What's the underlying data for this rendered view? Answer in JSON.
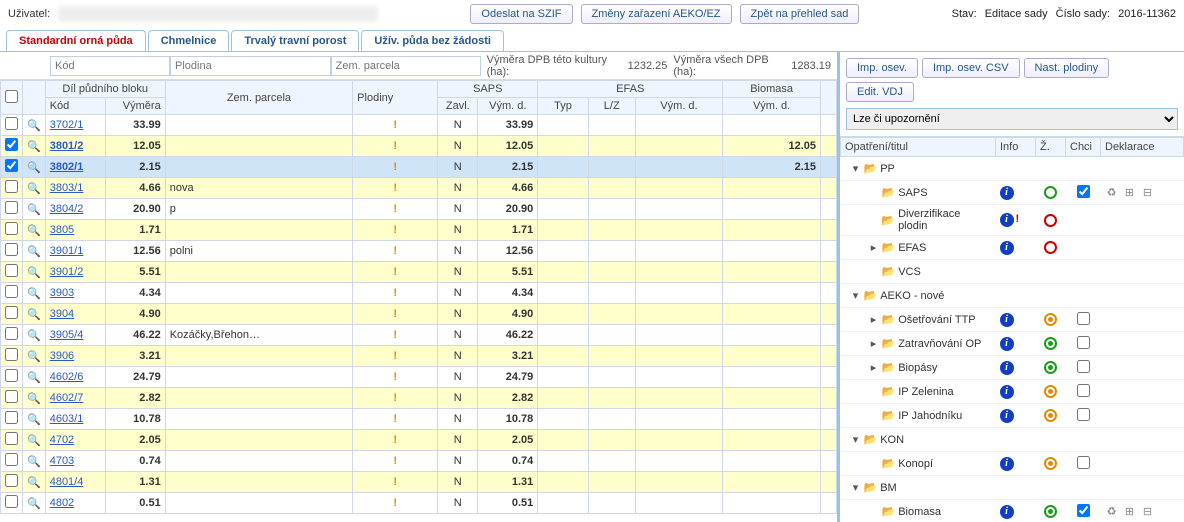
{
  "topbar": {
    "user_label": "Uživatel:",
    "btn_odeslat": "Odeslat na SZIF",
    "btn_zmeny": "Změny zařazení AEKO/EZ",
    "btn_zpet": "Zpět na přehled sad",
    "stav_label": "Stav:",
    "stav_value": "Editace sady",
    "cislo_label": "Číslo sady:",
    "cislo_value": "2016-11362"
  },
  "tabs": [
    "Standardní orná půda",
    "Chmelnice",
    "Trvalý travní porost",
    "Užív. půda bez žádosti"
  ],
  "filters": {
    "kod": "Kód",
    "plodina": "Plodina",
    "zem": "Zem. parcela",
    "metric1_label": "Výměra DPB této kultury (ha):",
    "metric1_value": "1232.25",
    "metric2_label": "Výměra všech DPB (ha):",
    "metric2_value": "1283.19"
  },
  "grid_headers": {
    "dpb": "Díl půdního bloku",
    "kod": "Kód",
    "vymera": "Výměra",
    "zem": "Zem. parcela",
    "plodiny": "Plodiny",
    "saps": "SAPS",
    "zavl": "Zavl.",
    "vymd": "Vým. d.",
    "efas": "EFAS",
    "typ": "Typ",
    "lz": "L/Z",
    "biomasa": "Biomasa"
  },
  "rows": [
    {
      "chk": false,
      "kod": "3702/1",
      "vym": "33.99",
      "zem": "",
      "excl": true,
      "zavl": "N",
      "sapsvym": "33.99",
      "biovym": "",
      "yellow": false
    },
    {
      "chk": true,
      "kod": "3801/2",
      "vym": "12.05",
      "zem": "",
      "excl": true,
      "zavl": "N",
      "sapsvym": "12.05",
      "biovym": "12.05",
      "yellow": true,
      "bold": true
    },
    {
      "chk": true,
      "kod": "3802/1",
      "vym": "2.15",
      "zem": "",
      "excl": true,
      "zavl": "N",
      "sapsvym": "2.15",
      "biovym": "2.15",
      "selblue": true,
      "bold": true
    },
    {
      "chk": false,
      "kod": "3803/1",
      "vym": "4.66",
      "zem": "nova",
      "excl": true,
      "zavl": "N",
      "sapsvym": "4.66",
      "biovym": "",
      "yellow": true
    },
    {
      "chk": false,
      "kod": "3804/2",
      "vym": "20.90",
      "zem": "p",
      "excl": true,
      "zavl": "N",
      "sapsvym": "20.90",
      "biovym": "",
      "yellow": false
    },
    {
      "chk": false,
      "kod": "3805",
      "vym": "1.71",
      "zem": "",
      "excl": true,
      "zavl": "N",
      "sapsvym": "1.71",
      "biovym": "",
      "yellow": true
    },
    {
      "chk": false,
      "kod": "3901/1",
      "vym": "12.56",
      "zem": "polni",
      "excl": true,
      "zavl": "N",
      "sapsvym": "12.56",
      "biovym": "",
      "yellow": false
    },
    {
      "chk": false,
      "kod": "3901/2",
      "vym": "5.51",
      "zem": "",
      "excl": true,
      "zavl": "N",
      "sapsvym": "5.51",
      "biovym": "",
      "yellow": true
    },
    {
      "chk": false,
      "kod": "3903",
      "vym": "4.34",
      "zem": "",
      "excl": true,
      "zavl": "N",
      "sapsvym": "4.34",
      "biovym": "",
      "yellow": false
    },
    {
      "chk": false,
      "kod": "3904",
      "vym": "4.90",
      "zem": "",
      "excl": true,
      "zavl": "N",
      "sapsvym": "4.90",
      "biovym": "",
      "yellow": true
    },
    {
      "chk": false,
      "kod": "3905/4",
      "vym": "46.22",
      "zem": "Kozáčky,Břehon…",
      "excl": true,
      "zavl": "N",
      "sapsvym": "46.22",
      "biovym": "",
      "yellow": false
    },
    {
      "chk": false,
      "kod": "3906",
      "vym": "3.21",
      "zem": "",
      "excl": true,
      "zavl": "N",
      "sapsvym": "3.21",
      "biovym": "",
      "yellow": true
    },
    {
      "chk": false,
      "kod": "4602/6",
      "vym": "24.79",
      "zem": "",
      "excl": true,
      "zavl": "N",
      "sapsvym": "24.79",
      "biovym": "",
      "yellow": false
    },
    {
      "chk": false,
      "kod": "4602/7",
      "vym": "2.82",
      "zem": "",
      "excl": true,
      "zavl": "N",
      "sapsvym": "2.82",
      "biovym": "",
      "yellow": true
    },
    {
      "chk": false,
      "kod": "4603/1",
      "vym": "10.78",
      "zem": "",
      "excl": true,
      "zavl": "N",
      "sapsvym": "10.78",
      "biovym": "",
      "yellow": false
    },
    {
      "chk": false,
      "kod": "4702",
      "vym": "2.05",
      "zem": "",
      "excl": true,
      "zavl": "N",
      "sapsvym": "2.05",
      "biovym": "",
      "yellow": true
    },
    {
      "chk": false,
      "kod": "4703",
      "vym": "0.74",
      "zem": "",
      "excl": true,
      "zavl": "N",
      "sapsvym": "0.74",
      "biovym": "",
      "yellow": false
    },
    {
      "chk": false,
      "kod": "4801/4",
      "vym": "1.31",
      "zem": "",
      "excl": true,
      "zavl": "N",
      "sapsvym": "1.31",
      "biovym": "",
      "yellow": true
    },
    {
      "chk": false,
      "kod": "4802",
      "vym": "0.51",
      "zem": "",
      "excl": true,
      "zavl": "N",
      "sapsvym": "0.51",
      "biovym": "",
      "yellow": false
    }
  ],
  "right": {
    "btn_imp_osev": "Imp. osev.",
    "btn_imp_csv": "Imp. osev. CSV",
    "btn_nast": "Nast. plodiny",
    "btn_edit_vdj": "Edit. VDJ",
    "select_value": "Lze či upozornění",
    "headers": {
      "op": "Opatření/titul",
      "info": "Info",
      "z": "Ž.",
      "chci": "Chci",
      "dekl": "Deklarace"
    },
    "tree": [
      {
        "level": 0,
        "arrow": "▾",
        "label": "PP"
      },
      {
        "level": 1,
        "arrow": "",
        "label": "SAPS",
        "info": true,
        "z": "ring-green",
        "chci": "chk-on",
        "dekl": true
      },
      {
        "level": 1,
        "arrow": "",
        "label": "Diverzifikace plodin",
        "info": true,
        "warn": true,
        "z": "ring-red"
      },
      {
        "level": 1,
        "arrow": "▸",
        "label": "EFAS",
        "info": true,
        "z": "ring-red"
      },
      {
        "level": 1,
        "arrow": "",
        "label": "VCS"
      },
      {
        "level": 0,
        "arrow": "▾",
        "label": "AEKO - nové"
      },
      {
        "level": 1,
        "arrow": "▸",
        "label": "Ošetřování TTP",
        "info": true,
        "z": "dot-orange",
        "chci": "chk-off"
      },
      {
        "level": 1,
        "arrow": "▸",
        "label": "Zatravňování OP",
        "info": true,
        "z": "dot-green",
        "chci": "chk-off"
      },
      {
        "level": 1,
        "arrow": "▸",
        "label": "Biopásy",
        "info": true,
        "z": "dot-green",
        "chci": "chk-off"
      },
      {
        "level": 1,
        "arrow": "",
        "label": "IP Zelenina",
        "info": true,
        "z": "dot-orange",
        "chci": "chk-off"
      },
      {
        "level": 1,
        "arrow": "",
        "label": "IP Jahodníku",
        "info": true,
        "z": "dot-orange",
        "chci": "chk-off"
      },
      {
        "level": 0,
        "arrow": "▾",
        "label": "KON"
      },
      {
        "level": 1,
        "arrow": "",
        "label": "Konopí",
        "info": true,
        "z": "dot-orange",
        "chci": "chk-off"
      },
      {
        "level": 0,
        "arrow": "▾",
        "label": "BM"
      },
      {
        "level": 1,
        "arrow": "",
        "label": "Biomasa",
        "info": true,
        "z": "dot-green",
        "chci": "chk-on",
        "dekl": true
      }
    ]
  }
}
